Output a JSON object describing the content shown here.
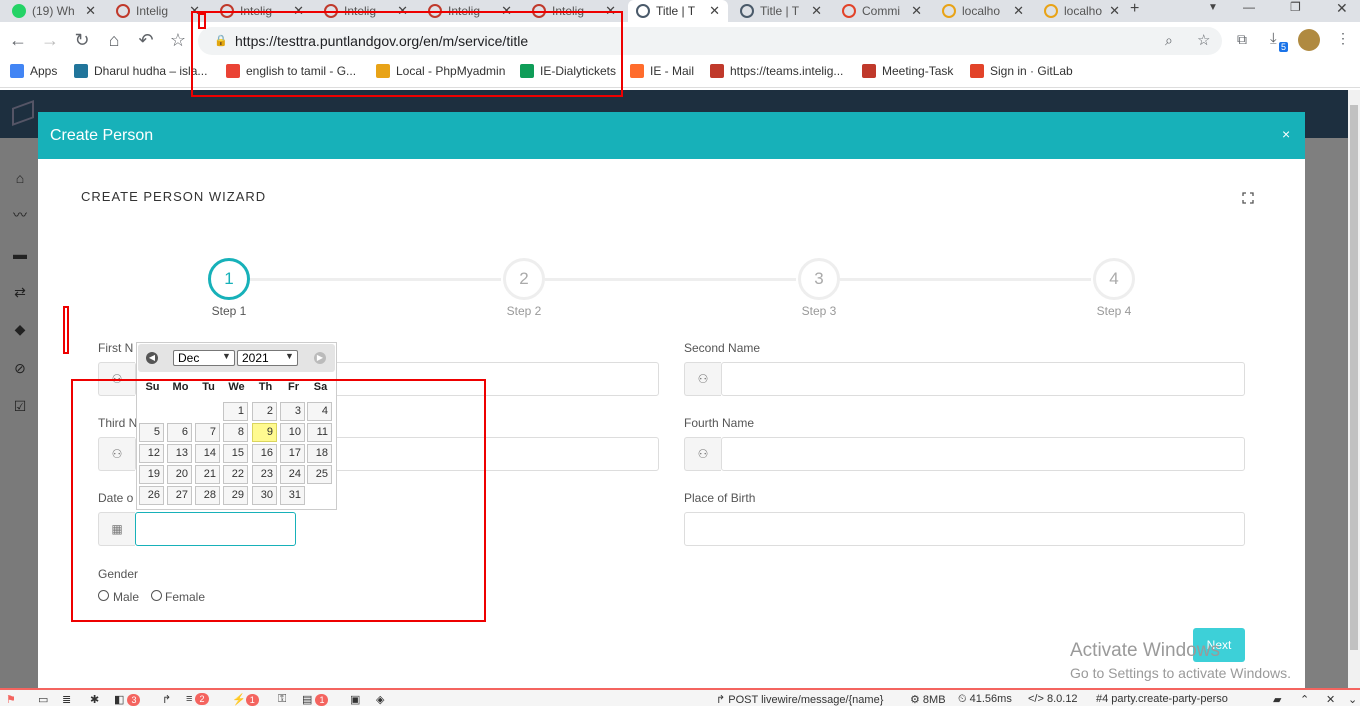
{
  "browser": {
    "tabs": [
      {
        "label": "(19) Wh",
        "icon": "whatsapp-icon"
      },
      {
        "label": "Intelig",
        "icon": "inteligo-icon"
      },
      {
        "label": "Intelig",
        "icon": "inteligo-icon"
      },
      {
        "label": "Intelig",
        "icon": "inteligo-icon"
      },
      {
        "label": "Intelig",
        "icon": "inteligo-icon"
      },
      {
        "label": "Intelig",
        "icon": "inteligo-icon"
      },
      {
        "label": "Title | T",
        "icon": "layers-icon"
      },
      {
        "label": "Title | T",
        "icon": "layers-icon"
      },
      {
        "label": "Commi",
        "icon": "gitlab-icon"
      },
      {
        "label": "localho",
        "icon": "phpmyadmin-icon"
      },
      {
        "label": "localho",
        "icon": "phpmyadmin-icon"
      }
    ],
    "url": "https://testtra.puntlandgov.org/en/m/service/title",
    "download_badge": "5",
    "bookmarks": [
      {
        "label": "Apps",
        "icon": "apps-icon"
      },
      {
        "label": "Dharul hudha – isla...",
        "icon": "wordpress-icon"
      },
      {
        "label": "english to tamil - G...",
        "icon": "google-icon"
      },
      {
        "label": "Local - PhpMyadmin",
        "icon": "phpmyadmin-icon"
      },
      {
        "label": "IE-Dialytickets",
        "icon": "sheets-icon"
      },
      {
        "label": "IE - Mail",
        "icon": "cpanel-icon"
      },
      {
        "label": "https://teams.intelig...",
        "icon": "inteligo-icon"
      },
      {
        "label": "Meeting-Task",
        "icon": "inteligo-icon"
      },
      {
        "label": "Sign in · GitLab",
        "icon": "gitlab-icon"
      }
    ]
  },
  "modal": {
    "title": "Create Person",
    "close": "×",
    "wizard_title": "CREATE PERSON WIZARD",
    "steps": [
      {
        "num": "1",
        "label": "Step 1"
      },
      {
        "num": "2",
        "label": "Step 2"
      },
      {
        "num": "3",
        "label": "Step 3"
      },
      {
        "num": "4",
        "label": "Step 4"
      }
    ],
    "fields": {
      "first_name": "First N",
      "second_name": "Second Name",
      "third_name": "Third N",
      "fourth_name": "Fourth Name",
      "date_of_birth": "Date o",
      "place_of_birth": "Place of Birth",
      "gender": "Gender",
      "male": "Male",
      "female": "Female"
    },
    "next": "Next"
  },
  "calendar": {
    "month": "Dec",
    "year": "2021",
    "dow": [
      "Su",
      "Mo",
      "Tu",
      "We",
      "Th",
      "Fr",
      "Sa"
    ],
    "today": "9",
    "weeks": [
      [
        "",
        "",
        "",
        "1",
        "2",
        "3",
        "4"
      ],
      [
        "5",
        "6",
        "7",
        "8",
        "9",
        "10",
        "11"
      ],
      [
        "12",
        "13",
        "14",
        "15",
        "16",
        "17",
        "18"
      ],
      [
        "19",
        "20",
        "21",
        "22",
        "23",
        "24",
        "25"
      ],
      [
        "26",
        "27",
        "28",
        "29",
        "30",
        "31",
        ""
      ]
    ]
  },
  "watermark": {
    "line1": "Activate Windows",
    "line2": "Go to Settings to activate Windows."
  },
  "debugbar": {
    "counts": [
      "3",
      "2",
      "1",
      "1"
    ],
    "request": "POST livewire/message/{name}",
    "memory": "8MB",
    "time": "41.56ms",
    "version": "8.0.12",
    "route": "#4 party.create-party-perso"
  }
}
